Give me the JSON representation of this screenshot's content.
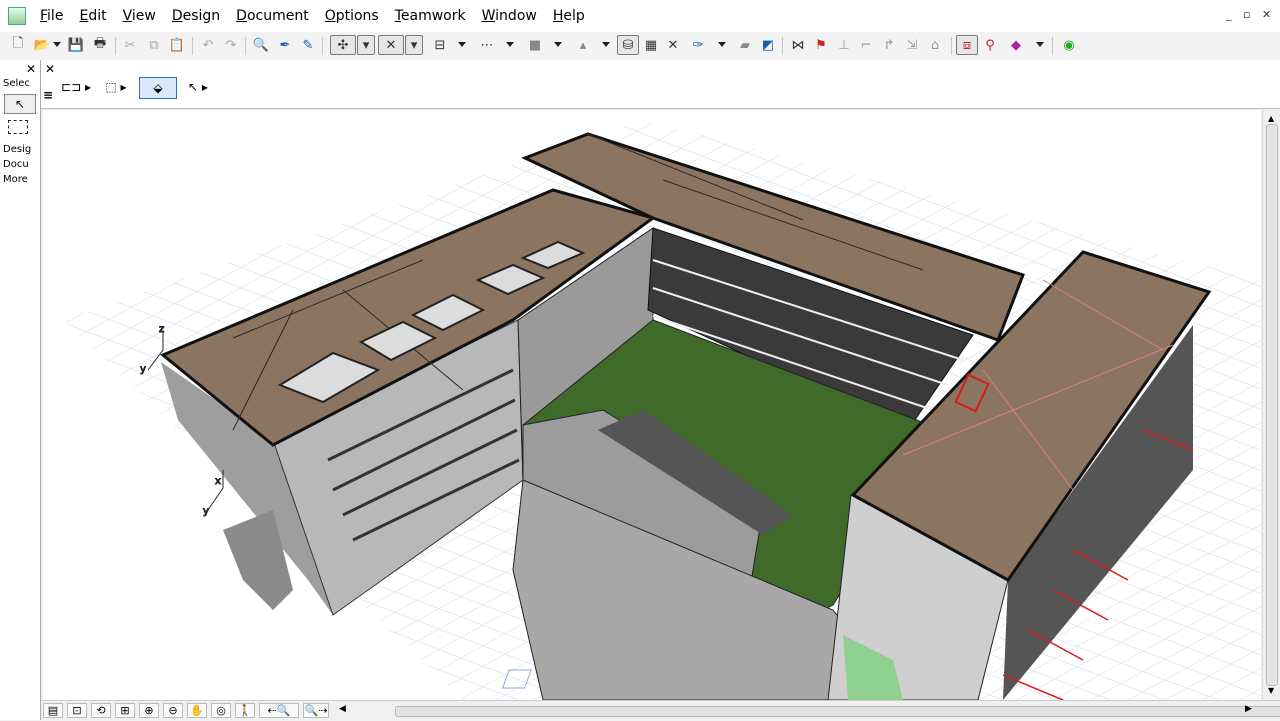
{
  "menu": {
    "items": [
      "File",
      "Edit",
      "View",
      "Design",
      "Document",
      "Options",
      "Teamwork",
      "Window",
      "Help"
    ]
  },
  "window_controls": [
    "_",
    "▫",
    "✕"
  ],
  "toolbox": {
    "close": "✕",
    "title": "Selec",
    "sections": [
      "Desig",
      "Docu",
      "More"
    ]
  },
  "infobox": {
    "close": "✕"
  },
  "icons": {
    "toolbar": [
      "new-icon",
      "open-icon",
      "save-icon",
      "print-icon",
      "cut-icon",
      "copy-icon",
      "paste-icon",
      "undo-icon",
      "redo-icon",
      "find-icon",
      "eyedropper-icon",
      "syringe-icon",
      "gravity-icon",
      "snap-icon",
      "layers-icon",
      "grid-icon",
      "fill-icon",
      "marker-icon",
      "teamwork-icon",
      "3d-window-icon",
      "render-icon"
    ]
  },
  "colors": {
    "roof": "#8b7560",
    "grass": "#3f6a2a",
    "wall": "#c4c4c4",
    "grid": "#c7d3ea",
    "accent_red": "#d81b1b"
  }
}
